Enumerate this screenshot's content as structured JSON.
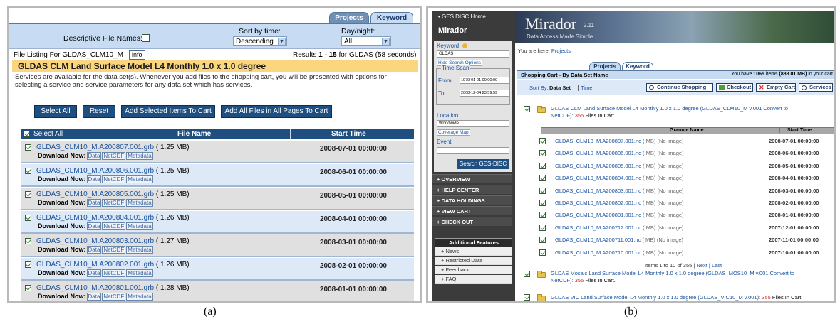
{
  "captions": {
    "a": "(a)",
    "b": "(b)"
  },
  "colors": {
    "nav_blue": "#1f4f80",
    "title_bar": "#fad67e",
    "header_blue": "#c7dcf3",
    "link": "#19529e",
    "dark_sidebar": "#4c4c4c",
    "highlight_red": "#cc2b2b"
  },
  "left": {
    "tabs": {
      "projects": "Projects",
      "keyword": "Keyword"
    },
    "options": {
      "descriptive_label": "Descriptive File Names:",
      "sort_label": "Sort by time:",
      "sort_value": "Descending",
      "daynight_label": "Day/night:",
      "daynight_value": "All"
    },
    "listing": {
      "label": "File Listing For GLDAS_CLM10_M",
      "info": "info",
      "results_prefix": "Results",
      "results_range": "1 - 15",
      "results_suffix": "for GLDAS (58 seconds)"
    },
    "title": "GLDAS CLM Land Surface Model L4 Monthly 1.0 x 1.0 degree",
    "notice": "Services are available for the data set(s). Whenever you add files to the shopping cart, you will be presented with options for selecting a service and service parameters for any data set which has services.",
    "buttons": {
      "select_all": "Select All",
      "reset": "Reset",
      "add_selected": "Add Selected Items To Cart",
      "add_all": "Add All Files in All Pages To Cart"
    },
    "table": {
      "select_all_header": "Select All",
      "file_name_header": "File Name",
      "start_time_header": "Start Time",
      "download_label": "Download Now:",
      "dl_buttons": [
        "Data",
        "NetCDF",
        "Metadata"
      ],
      "rows": [
        {
          "name": "GLDAS_CLM10_M.A200807.001.grb",
          "size": "( 1.25 MB)",
          "time": "2008-07-01 00:00:00"
        },
        {
          "name": "GLDAS_CLM10_M.A200806.001.grb",
          "size": "( 1.25 MB)",
          "time": "2008-06-01 00:00:00"
        },
        {
          "name": "GLDAS_CLM10_M.A200805.001.grb",
          "size": "( 1.25 MB)",
          "time": "2008-05-01 00:00:00"
        },
        {
          "name": "GLDAS_CLM10_M.A200804.001.grb",
          "size": "( 1.26 MB)",
          "time": "2008-04-01 00:00:00"
        },
        {
          "name": "GLDAS_CLM10_M.A200803.001.grb",
          "size": "( 1.27 MB)",
          "time": "2008-03-01 00:00:00"
        },
        {
          "name": "GLDAS_CLM10_M.A200802.001.grb",
          "size": "( 1.26 MB)",
          "time": "2008-02-01 00:00:00"
        },
        {
          "name": "GLDAS_CLM10_M.A200801.001.grb",
          "size": "( 1.28 MB)",
          "time": "2008-01-01 00:00:00"
        }
      ]
    }
  },
  "right": {
    "sidebar": {
      "home_link": "• GES DISC Home",
      "app_name": "Mirador",
      "keyword_label": "Keyword",
      "keyword_value": "GLDAS",
      "hide_search": "Hide Search Options",
      "time_span_label": "Time Span",
      "from_label": "From",
      "from_value": "1979-01-01 00:00:00",
      "to_label": "To",
      "to_value": "2008-12-04 23:59:59",
      "location_label": "Location",
      "location_value": "Worldwide",
      "coverage_map": "Coverage Map",
      "event_label": "Event",
      "search_button": "Search GES-DISC",
      "nav": [
        "+ OVERVIEW",
        "+ HELP CENTER",
        "+ DATA HOLDINGS",
        "+ VIEW CART",
        "+ CHECK OUT"
      ],
      "features_title": "Additional Features",
      "features": [
        "+ News",
        "+ Restricted Data",
        "+ Feedback",
        "+ FAQ"
      ]
    },
    "banner": {
      "title": "Mirador",
      "version": "2.11",
      "subtitle": "Data Access Made Simple"
    },
    "breadcrumb_prefix": "You are here:",
    "breadcrumb_link": "Projects",
    "tabs": {
      "projects": "Projects",
      "keyword": "Keyword"
    },
    "cart_heading": "Shopping Cart - By Data Set Name",
    "cart_count_prefix": "You have",
    "cart_count": "1065",
    "cart_count_mid": "items",
    "cart_size": "(888.01 MB)",
    "cart_count_suffix": "in your cart",
    "sort_by": "Sort By:",
    "sort_data_set": "Data Set",
    "sort_time": "Time",
    "actions": {
      "continue": "Continue Shopping",
      "checkout": "Checkout",
      "empty": "Empty Cart",
      "services": "Services"
    },
    "dataset1": {
      "name": "GLDAS CLM Land Surface Model L4 Monthly 1.0 x 1.0 degree (GLDAS_CLM10_M v.001 Convert to",
      "name2": "NetCDF):",
      "count": "355",
      "count_suffix": "Files In Cart."
    },
    "granule_table": {
      "name_header": "Granule Name",
      "time_header": "Start Time",
      "mb": "( MB)",
      "no_image": "(No image)",
      "rows": [
        {
          "name": "GLDAS_CLM10_M.A200807.001.nc",
          "time": "2008-07-01 00:00:00"
        },
        {
          "name": "GLDAS_CLM10_M.A200806.001.nc",
          "time": "2008-06-01 00:00:00"
        },
        {
          "name": "GLDAS_CLM10_M.A200805.001.nc",
          "time": "2008-05-01 00:00:00"
        },
        {
          "name": "GLDAS_CLM10_M.A200804.001.nc",
          "time": "2008-04-01 00:00:00"
        },
        {
          "name": "GLDAS_CLM10_M.A200803.001.nc",
          "time": "2008-03-01 00:00:00"
        },
        {
          "name": "GLDAS_CLM10_M.A200802.001.nc",
          "time": "2008-02-01 00:00:00"
        },
        {
          "name": "GLDAS_CLM10_M.A200801.001.nc",
          "time": "2008-01-01 00:00:00"
        },
        {
          "name": "GLDAS_CLM10_M.A200712.001.nc",
          "time": "2007-12-01 00:00:00"
        },
        {
          "name": "GLDAS_CLM10_M.A200711.001.nc",
          "time": "2007-11-01 00:00:00"
        },
        {
          "name": "GLDAS_CLM10_M.A200710.001.nc",
          "time": "2007-10-01 00:00:00"
        }
      ],
      "pager": "Items 1 to 10 of 355",
      "pager_next": "Next",
      "pager_last": "Last"
    },
    "dataset2": {
      "name": "GLDAS Mosaic Land Surface Model L4 Monthly 1.0 x 1.0 degree (GLDAS_MOS10_M v.001 Convert to",
      "name2": "NetCDF):",
      "count": "355",
      "count_suffix": "Files In Cart."
    },
    "dataset3": {
      "name": "GLDAS VIC Land Surface Model L4 Monthly 1.0 x 1.0 degree (GLDAS_VIC10_M v.001):",
      "count": "355",
      "count_suffix": "Files In Cart."
    }
  }
}
